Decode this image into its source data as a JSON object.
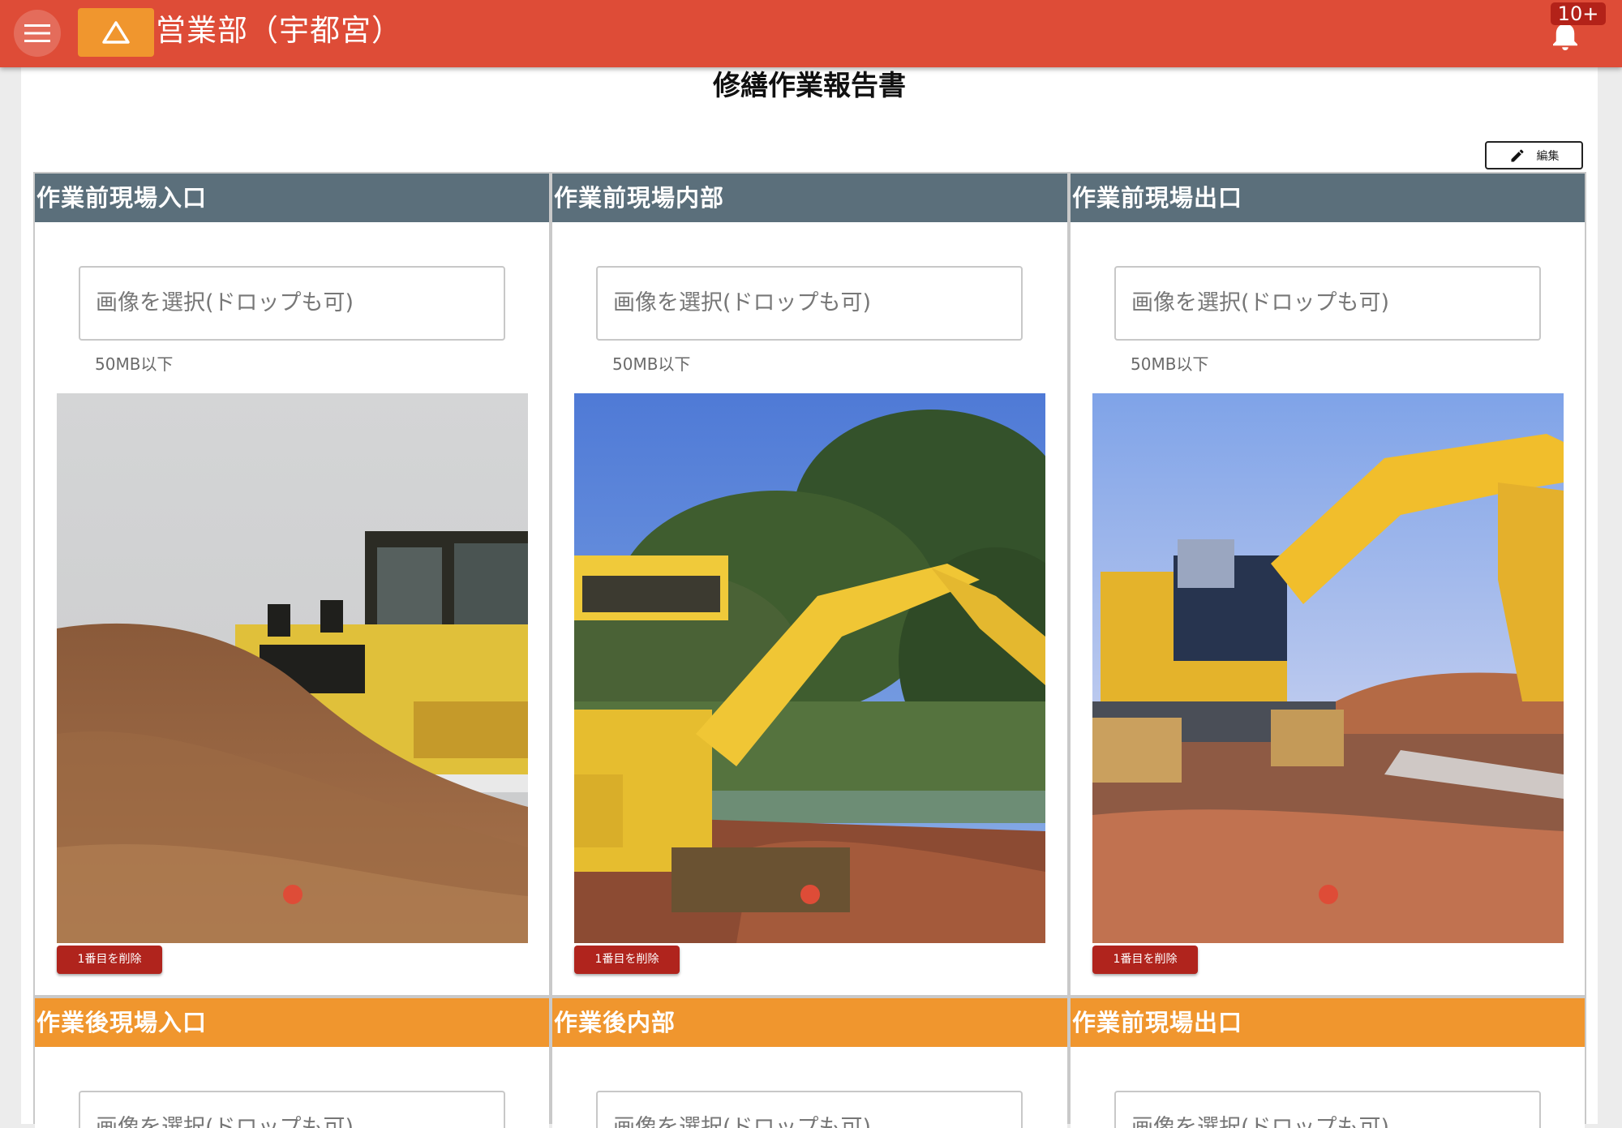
{
  "header": {
    "title": "営業部（宇都宮）",
    "notification_count": "10+",
    "colors": {
      "bar": "#de4c37",
      "logo": "#f0962e",
      "badge": "#b32219"
    }
  },
  "page": {
    "title": "修繕作業報告書",
    "edit_label": "編集"
  },
  "colors": {
    "before_header": "#5b6f7b",
    "after_header": "#f0962e",
    "delete_button": "#b0241d"
  },
  "sections_before": [
    {
      "title": "作業前現場入口",
      "placeholder": "画像を選択(ドロップも可)",
      "size_note": "50MB以下",
      "delete_label": "1番目を削除",
      "photo": "bulldozer-on-wood-chips"
    },
    {
      "title": "作業前現場内部",
      "placeholder": "画像を選択(ドロップも可)",
      "size_note": "50MB以下",
      "delete_label": "1番目を削除",
      "photo": "excavator-near-trees"
    },
    {
      "title": "作業前現場出口",
      "placeholder": "画像を選択(ドロップも可)",
      "size_note": "50MB以下",
      "delete_label": "1番目を削除",
      "photo": "excavator-on-dirt-site"
    }
  ],
  "sections_after": [
    {
      "title": "作業後現場入口",
      "placeholder": "画像を選択(ドロップも可)"
    },
    {
      "title": "作業後内部",
      "placeholder": "画像を選択(ドロップも可)"
    },
    {
      "title": "作業前現場出口",
      "placeholder": "画像を選択(ドロップも可)"
    }
  ]
}
